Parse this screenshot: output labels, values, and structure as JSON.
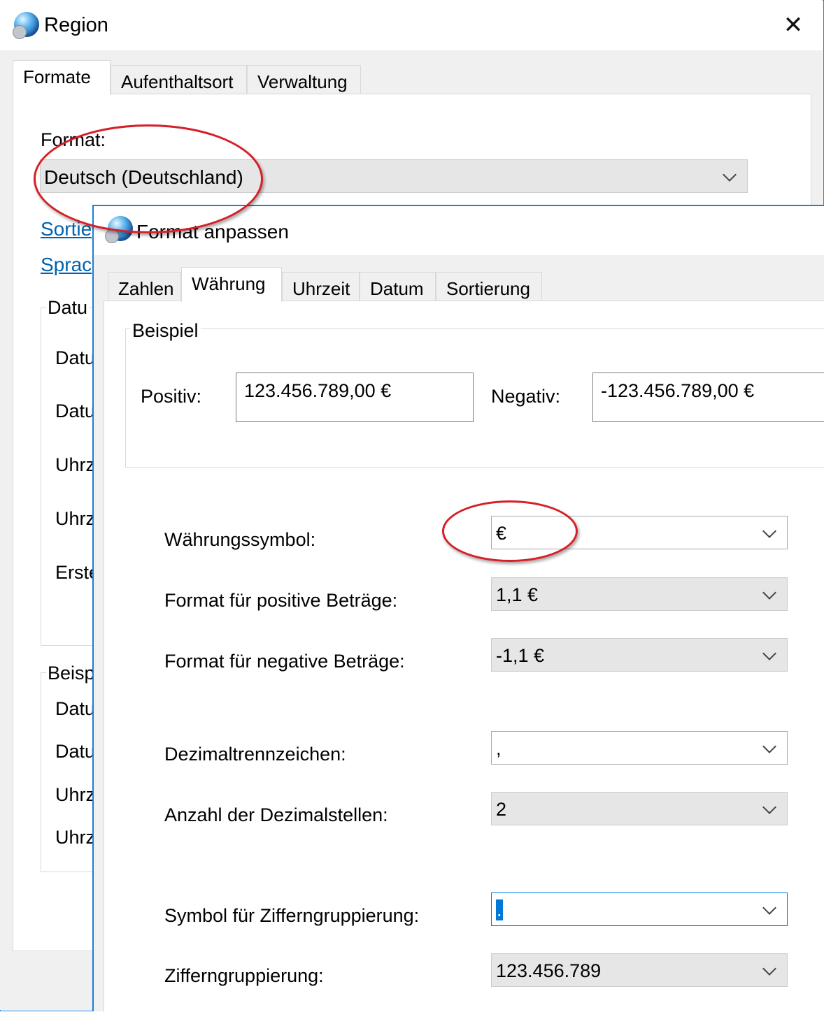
{
  "region_window": {
    "title": "Region",
    "tabs": [
      {
        "label": "Formate"
      },
      {
        "label": "Aufenthaltsort"
      },
      {
        "label": "Verwaltung"
      }
    ],
    "format_label": "Format:",
    "format_value": "Deutsch (Deutschland)",
    "links": [
      {
        "label": "Sortie"
      },
      {
        "label": "Sprac"
      }
    ],
    "group_title_1": "Datu",
    "group1_items": [
      "Datu",
      "Datu",
      "Uhrz",
      "Uhrz",
      "Erste"
    ],
    "group_title_2": "Beisp",
    "group2_items": [
      "Datu",
      "Datu",
      "Uhrz",
      "Uhrz"
    ]
  },
  "format_window": {
    "title": "Format anpassen",
    "tabs": [
      {
        "label": "Zahlen"
      },
      {
        "label": "Währung"
      },
      {
        "label": "Uhrzeit"
      },
      {
        "label": "Datum"
      },
      {
        "label": "Sortierung"
      }
    ],
    "active_tab": "Währung",
    "example": {
      "legend": "Beispiel",
      "positive_label": "Positiv:",
      "positive_value": "123.456.789,00 €",
      "negative_label": "Negativ:",
      "negative_value": "-123.456.789,00 €"
    },
    "fields": {
      "currency_symbol": {
        "label": "Währungssymbol:",
        "value": "€"
      },
      "positive_format": {
        "label": "Format für positive Beträge:",
        "value": "1,1 €"
      },
      "negative_format": {
        "label": "Format für negative Beträge:",
        "value": "-1,1 €"
      },
      "decimal_separator": {
        "label": "Dezimaltrennzeichen:",
        "value": ","
      },
      "decimal_places": {
        "label": "Anzahl der Dezimalstellen:",
        "value": "2"
      },
      "grouping_symbol": {
        "label": "Symbol für Zifferngruppierung:",
        "value": "."
      },
      "grouping": {
        "label": "Zifferngruppierung:",
        "value": "123.456.789"
      }
    }
  },
  "colors": {
    "window_border": "#1e7fd6",
    "annotation_ellipse": "#d61f26",
    "link": "#0063b1",
    "dialog_bg": "#f0f0f0"
  }
}
